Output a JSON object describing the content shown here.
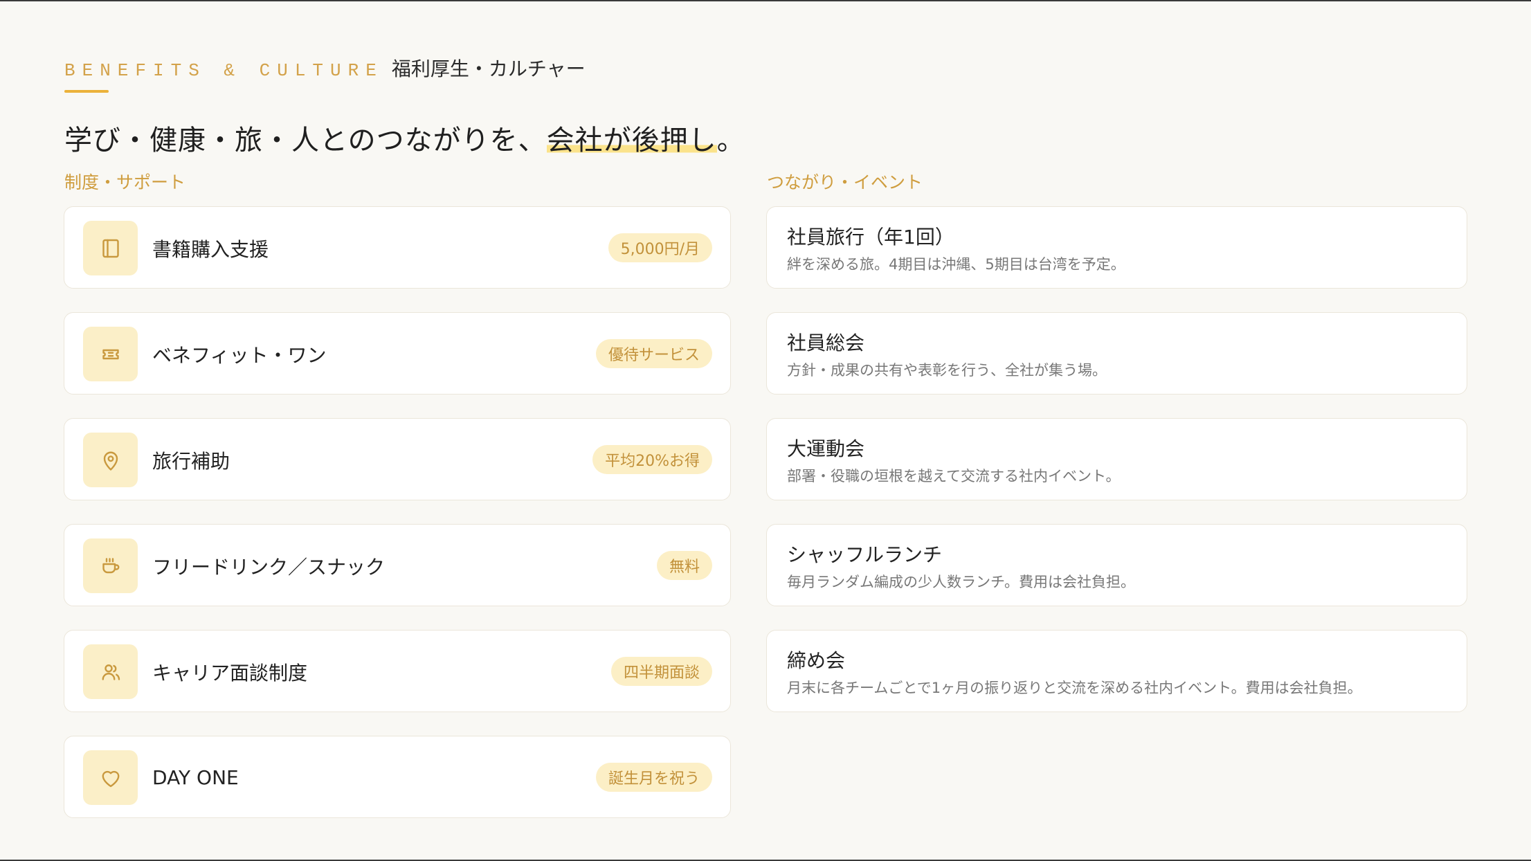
{
  "section": {
    "eyebrow_en": "BENEFITS & CULTURE",
    "eyebrow_jp": "福利厚生・カルチャー",
    "headline_prefix": "学び・健康・旅・人とのつながりを、",
    "headline_highlight": "会社が後押し",
    "headline_suffix": "。"
  },
  "colors": {
    "accent": "#ecb23a",
    "accent_text": "#cf9d3e",
    "badge_bg": "#fcefc6",
    "icon_bg": "#fbefc8",
    "background": "#f9f8f4",
    "card_bg": "#ffffff"
  },
  "benefits": {
    "label": "制度・サポート",
    "items": [
      {
        "icon": "book-icon",
        "title": "書籍購入支援",
        "badge": "5,000円/月"
      },
      {
        "icon": "ticket-icon",
        "title": "ベネフィット・ワン",
        "badge": "優待サービス"
      },
      {
        "icon": "map-pin-icon",
        "title": "旅行補助",
        "badge": "平均20%お得"
      },
      {
        "icon": "coffee-cup-icon",
        "title": "フリードリンク／スナック",
        "badge": "無料"
      },
      {
        "icon": "users-icon",
        "title": "キャリア面談制度",
        "badge": "四半期面談"
      },
      {
        "icon": "heart-icon",
        "title": "DAY ONE",
        "badge": "誕生月を祝う"
      }
    ]
  },
  "events": {
    "label": "つながり・イベント",
    "items": [
      {
        "title": "社員旅行（年1回）",
        "desc": "絆を深める旅。4期目は沖縄、5期目は台湾を予定。"
      },
      {
        "title": "社員総会",
        "desc": "方針・成果の共有や表彰を行う、全社が集う場。"
      },
      {
        "title": "大運動会",
        "desc": "部署・役職の垣根を越えて交流する社内イベント。"
      },
      {
        "title": "シャッフルランチ",
        "desc": "毎月ランダム編成の少人数ランチ。費用は会社負担。"
      },
      {
        "title": "締め会",
        "desc": "月末に各チームごとで1ヶ月の振り返りと交流を深める社内イベント。費用は会社負担。"
      }
    ]
  }
}
